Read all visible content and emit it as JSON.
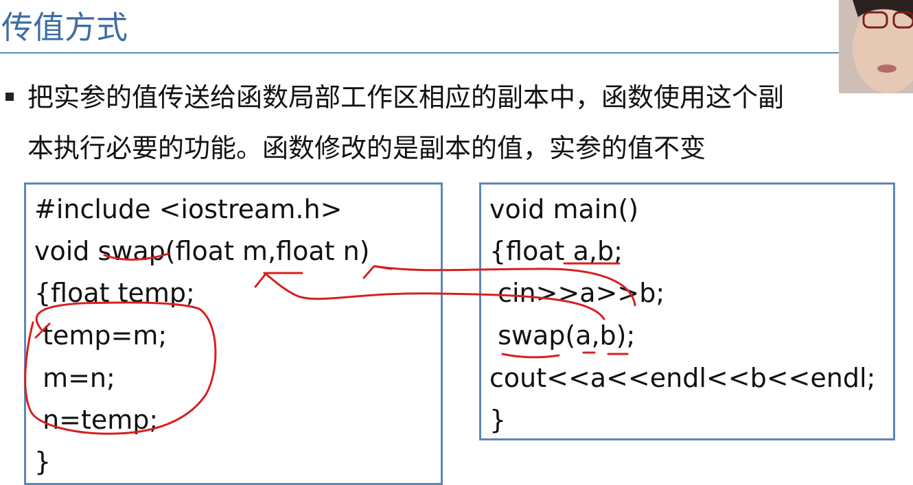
{
  "slide": {
    "title": "传值方式",
    "bullet": {
      "line1": "把实参的值传送给函数局部工作区相应的副本中，函数使用这个副",
      "line2": "本执行必要的功能。函数修改的是副本的值，实参的值不变"
    }
  },
  "code_left": {
    "lines": [
      "#include <iostream.h>",
      "void swap(float m,float n)",
      "{float temp;",
      " temp=m;",
      " m=n;",
      " n=temp;",
      "}"
    ]
  },
  "code_right": {
    "lines": [
      "void main()",
      "{float a,b;",
      " cin>>a>>b;",
      " swap(a,b);",
      "cout<<a<<endl<<b<<endl;",
      "}"
    ]
  },
  "colors": {
    "title": "#3d6da4",
    "box_border": "#5f86b8",
    "annotation": "#d81e1e"
  }
}
